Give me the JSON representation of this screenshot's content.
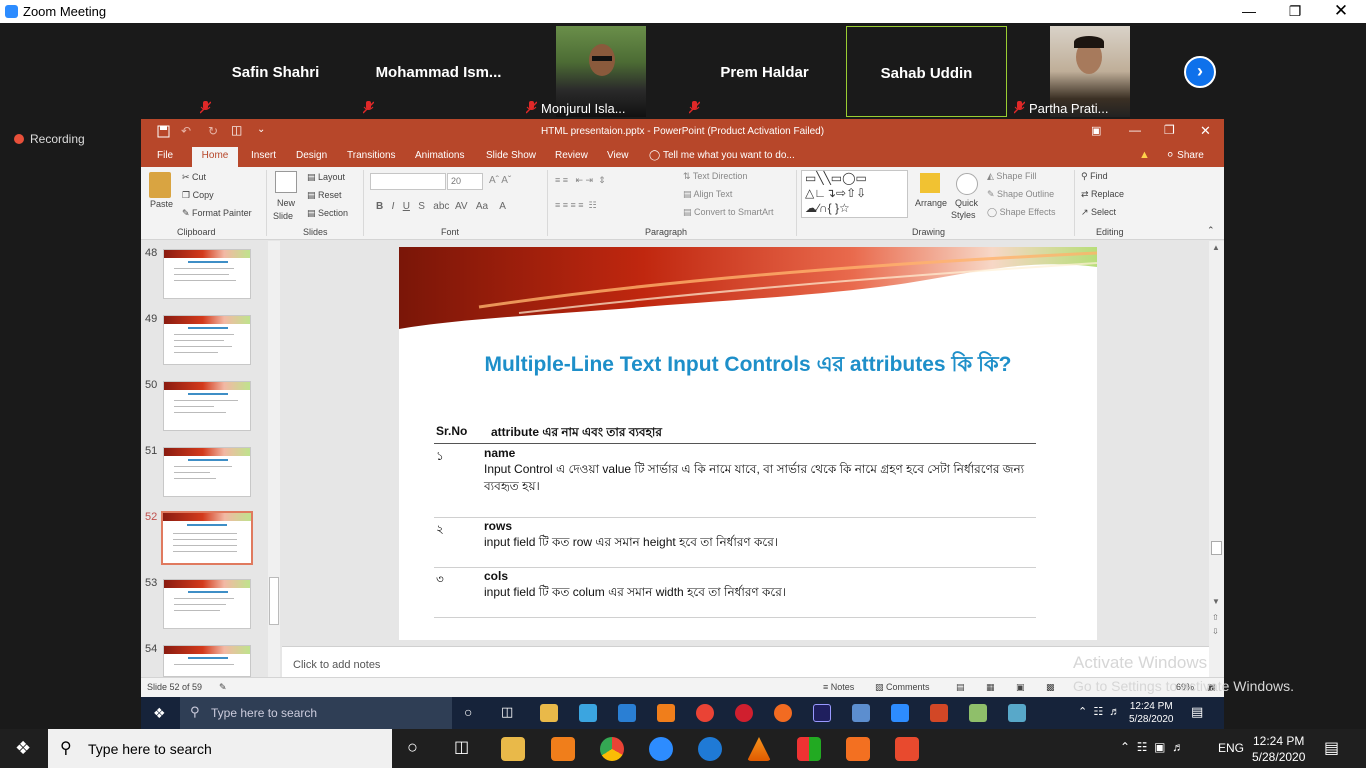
{
  "zoom": {
    "window_title": "Zoom Meeting",
    "recording_label": "Recording",
    "participants": [
      {
        "name": "Safin Shahri"
      },
      {
        "name": "Mohammad  Ism..."
      },
      {
        "name": "Monjurul Isla..."
      },
      {
        "name": "Prem Haldar"
      },
      {
        "name": "Sahab Uddin"
      },
      {
        "name": "Partha Prati..."
      }
    ]
  },
  "ppt": {
    "title": "HTML presentaion.pptx - PowerPoint (Product Activation Failed)",
    "tabs": [
      "File",
      "Home",
      "Insert",
      "Design",
      "Transitions",
      "Animations",
      "Slide Show",
      "Review",
      "View"
    ],
    "tell_me": "Tell me what you want to do...",
    "share": "Share",
    "ribbon": {
      "cut": "Cut",
      "copy": "Copy",
      "format_painter": "Format Painter",
      "paste": "Paste",
      "new_slide": "New",
      "new_slide2": "Slide",
      "layout": "Layout",
      "reset": "Reset",
      "section": "Section",
      "font_size": "20",
      "text_direction": "Text Direction",
      "align_text": "Align Text",
      "convert_smartart": "Convert to SmartArt",
      "arrange": "Arrange",
      "quick_styles": "Quick",
      "quick_styles2": "Styles",
      "shape_fill": "Shape Fill",
      "shape_outline": "Shape Outline",
      "shape_effects": "Shape Effects",
      "find": "Find",
      "replace": "Replace",
      "select": "Select",
      "groups": {
        "clipboard": "Clipboard",
        "slides": "Slides",
        "font": "Font",
        "paragraph": "Paragraph",
        "drawing": "Drawing",
        "editing": "Editing"
      }
    },
    "thumbnails": [
      {
        "num": "48"
      },
      {
        "num": "49"
      },
      {
        "num": "50"
      },
      {
        "num": "51"
      },
      {
        "num": "52"
      },
      {
        "num": "53"
      },
      {
        "num": "54"
      }
    ],
    "slide": {
      "title": "Multiple-Line Text Input Controls এর attributes কি কি?",
      "col1": "Sr.No",
      "col2": "attribute এর নাম এবং তার ব্যবহার",
      "rows": [
        {
          "num": "১",
          "name": "name",
          "desc": "Input Control এ দেওয়া value টি সার্ভার এ কি নামে যাবে, বা সার্ভার থেকে কি নামে গ্রহণ হবে সেটা নির্ধারণের জন্য ব্যবহৃত হয়।"
        },
        {
          "num": "২",
          "name": "rows",
          "desc": "input field টি কত row এর সমান height হবে তা নির্ধারণ করে।"
        },
        {
          "num": "৩",
          "name": "cols",
          "desc": "input field টি কত colum এর সমান width হবে তা নির্ধারণ করে।"
        }
      ]
    },
    "notes_placeholder": "Click to add notes",
    "status": {
      "slide_count": "Slide 52 of 59",
      "notes": "Notes",
      "comments": "Comments",
      "zoom": "69%"
    }
  },
  "watermark": {
    "line1": "Activate Windows",
    "line2": "Go to Settings to activate Windows."
  },
  "inner_taskbar": {
    "search": "Type here to search",
    "time": "12:24 PM",
    "date": "5/28/2020"
  },
  "taskbar": {
    "search": "Type here to search",
    "lang": "ENG",
    "time": "12:24 PM",
    "date": "5/28/2020"
  }
}
